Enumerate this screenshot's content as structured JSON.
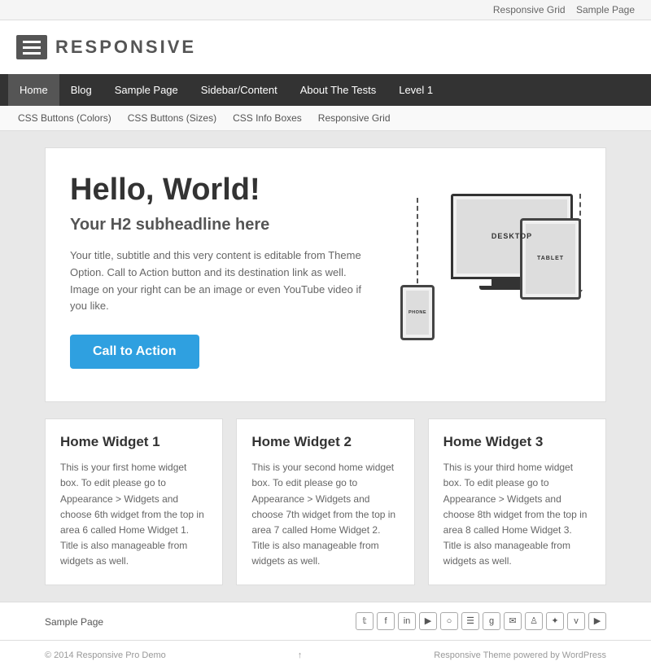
{
  "topbar": {
    "links": [
      {
        "label": "Responsive Grid",
        "href": "#"
      },
      {
        "label": "Sample Page",
        "href": "#"
      }
    ]
  },
  "logo": {
    "text": "RESPONSIVE"
  },
  "main_nav": {
    "items": [
      {
        "label": "Home",
        "active": true
      },
      {
        "label": "Blog"
      },
      {
        "label": "Sample Page"
      },
      {
        "label": "Sidebar/Content"
      },
      {
        "label": "About The Tests"
      },
      {
        "label": "Level 1"
      }
    ]
  },
  "sub_nav": {
    "items": [
      {
        "label": "CSS Buttons (Colors)"
      },
      {
        "label": "CSS Buttons (Sizes)"
      },
      {
        "label": "CSS Info Boxes"
      },
      {
        "label": "Responsive Grid"
      }
    ]
  },
  "hero": {
    "h1": "Hello, World!",
    "h2": "Your H2 subheadline here",
    "body": "Your title, subtitle and this very content is editable from Theme Option. Call to Action button and its destination link as well. Image on your right can be an image or even YouTube video if you like.",
    "cta_label": "Call to Action",
    "device_labels": {
      "desktop": "DESKTOP",
      "tablet": "TABLET",
      "phone": "PHONE"
    }
  },
  "widgets": [
    {
      "title": "Home Widget 1",
      "body": "This is your first home widget box. To edit please go to Appearance > Widgets and choose 6th widget from the top in area 6 called Home Widget 1. Title is also manageable from widgets as well."
    },
    {
      "title": "Home Widget 2",
      "body": "This is your second home widget box. To edit please go to Appearance > Widgets and choose 7th widget from the top in area 7 called Home Widget 2. Title is also manageable from widgets as well."
    },
    {
      "title": "Home Widget 3",
      "body": "This is your third home widget box. To edit please go to Appearance > Widgets and choose 8th widget from the top in area 8 called Home Widget 3. Title is also manageable from widgets as well."
    }
  ],
  "footer": {
    "link": "Sample Page",
    "social_icons": [
      "𝕏",
      "f",
      "in",
      "▶",
      "⊙",
      "RSS",
      "g+",
      "✉",
      "📌",
      "☆",
      "v",
      "▶"
    ],
    "social_chars": [
      "𝕥",
      "f",
      "in",
      "▶",
      "○",
      "☰",
      "g",
      "✉",
      "♙",
      "✦",
      "v",
      "▶"
    ],
    "copyright": "© 2014 Responsive Pro Demo",
    "powered": "Responsive Theme powered by WordPress"
  }
}
